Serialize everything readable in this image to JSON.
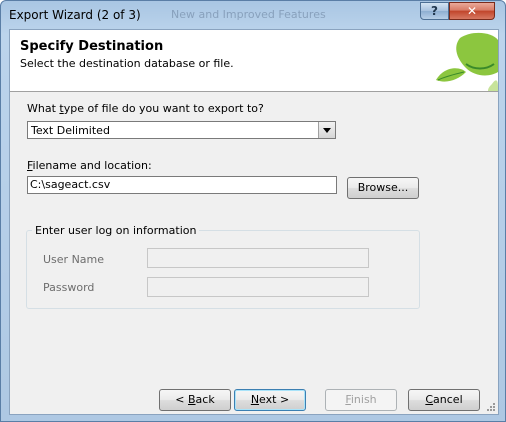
{
  "window": {
    "title": "Export Wizard (2 of 3)",
    "background_title": "New and Improved Features",
    "help_glyph": "?",
    "close_glyph": "✕"
  },
  "header": {
    "title": "Specify Destination",
    "subtitle": "Select the destination database or file."
  },
  "file_type": {
    "label_pre": "What ",
    "label_accel": "t",
    "label_post": "ype of file do you want to export to?",
    "selected": "Text Delimited"
  },
  "filename": {
    "label_accel": "F",
    "label_post": "ilename and location:",
    "value": "C:\\sageact.csv",
    "browse_label": "Browse..."
  },
  "logon": {
    "group_title": "Enter user log on information",
    "user_label": "User Name",
    "password_label": "Password",
    "user_value": "",
    "password_value": ""
  },
  "buttons": {
    "back_glyph": "< ",
    "back_accel": "B",
    "back_rest": "ack",
    "next_accel": "N",
    "next_rest": "ext >",
    "finish_accel": "F",
    "finish_rest": "inish",
    "cancel_accel": "C",
    "cancel_rest": "ancel"
  },
  "colors": {
    "logo_green": "#8cc63f",
    "logo_dark_green": "#3a8a2a",
    "default_button_border": "#3c7fb1"
  },
  "icons": [
    "help-icon",
    "close-icon",
    "dropdown-arrow-icon",
    "resize-grip-icon"
  ]
}
